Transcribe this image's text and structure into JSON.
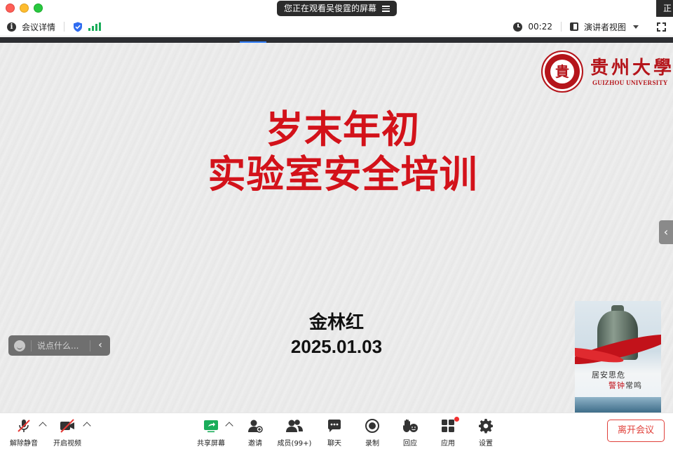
{
  "titlebar": {
    "watching_text": "您正在观看吴俊霆的屏幕",
    "corner_tab_text": "正在"
  },
  "infobar": {
    "meeting_details_label": "会议详情",
    "timer": "00:22",
    "view_mode_label": "演讲者视图"
  },
  "slide": {
    "logo_cn": "贵州大學",
    "logo_en": "GUIZHOU UNIVERSITY",
    "seal_char": "貴",
    "title_line1": "岁末年初",
    "title_line2": "实验室安全培训",
    "presenter": "金林红",
    "date": "2025.01.03",
    "bell_text1": "居安思危",
    "bell_text2_red": "警钟",
    "bell_text2_rest": "常鸣"
  },
  "chat": {
    "placeholder": "说点什么..."
  },
  "toolbar": {
    "unmute_label": "解除静音",
    "start_video_label": "开启视频",
    "share_screen_label": "共享屏幕",
    "invite_label": "邀请",
    "members_label": "成员(99+)",
    "chat_label": "聊天",
    "record_label": "录制",
    "react_label": "回应",
    "apps_label": "应用",
    "settings_label": "设置",
    "leave_label": "离开会议"
  },
  "colors": {
    "title_red": "#d3121a",
    "brand_red": "#b5151b",
    "leave_red": "#e0403a",
    "accent_green": "#1aad5a",
    "accent_blue": "#2f7cf6"
  }
}
